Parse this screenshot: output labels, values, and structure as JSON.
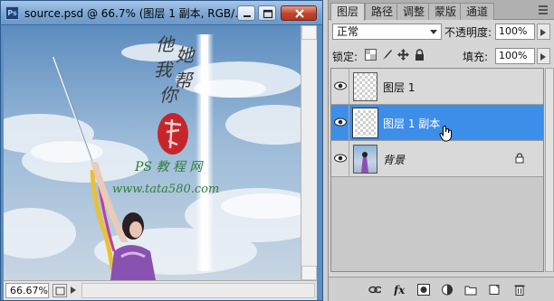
{
  "document": {
    "title": "source.psd @ 66.7% (图层 1 副本, RGB/...",
    "zoom": "66.67%",
    "artwork": {
      "calligraphy": [
        "他",
        "她",
        "我",
        "帮",
        "你"
      ],
      "watermark_brand": "PS 教 程 网",
      "watermark_url": "www.tata580.com"
    }
  },
  "panel": {
    "tabs": [
      {
        "label": "图层",
        "active": true
      },
      {
        "label": "路径",
        "active": false
      },
      {
        "label": "调整",
        "active": false
      },
      {
        "label": "蒙版",
        "active": false
      },
      {
        "label": "通道",
        "active": false
      }
    ],
    "blend_mode": "正常",
    "opacity_label": "不透明度:",
    "opacity_value": "100%",
    "lock_label": "锁定:",
    "fill_label": "填充:",
    "fill_value": "100%",
    "layers": [
      {
        "name": "图层 1",
        "selected": false,
        "visible": true
      },
      {
        "name": "图层 1 副本",
        "selected": true,
        "visible": true
      },
      {
        "name": "背景",
        "selected": false,
        "visible": true,
        "locked": true
      }
    ]
  },
  "colors": {
    "selection": "#3d8ee8",
    "title_bar": "#7ca6d3",
    "close_button": "#c1432b"
  }
}
